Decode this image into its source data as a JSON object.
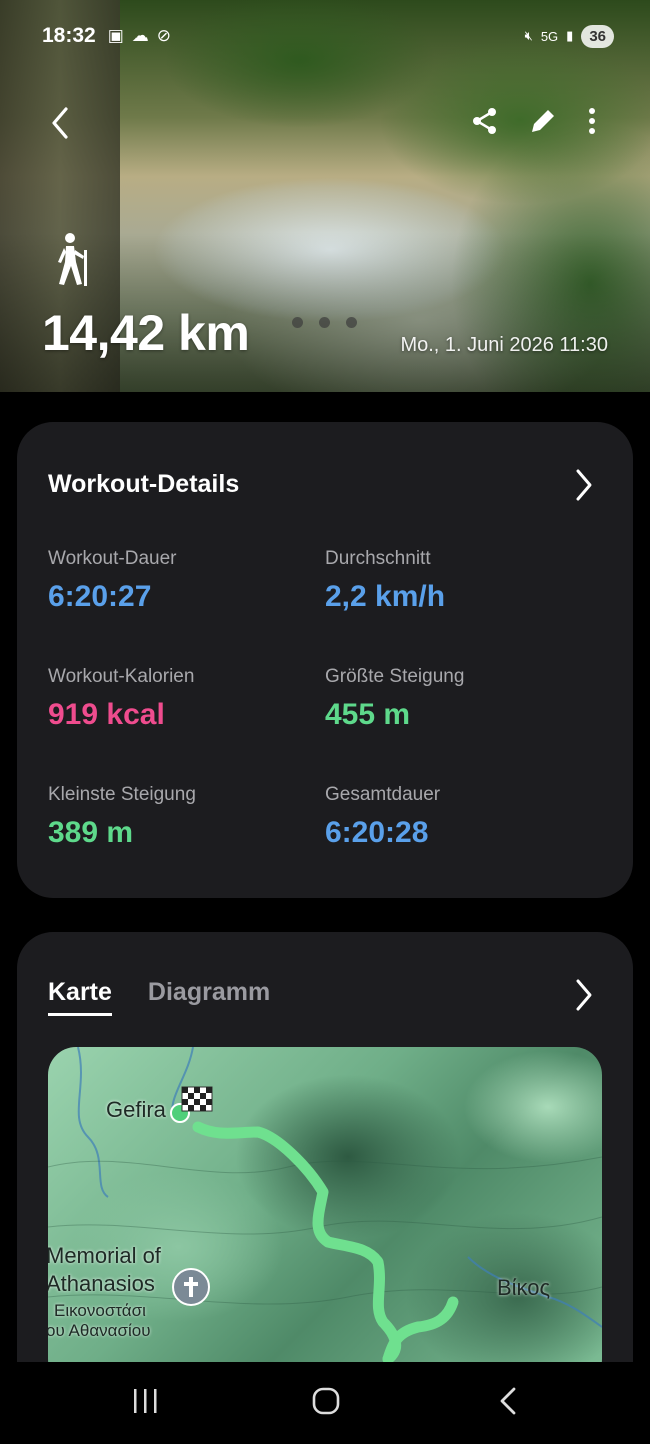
{
  "status_bar": {
    "time": "18:32",
    "network": "5G",
    "battery": "36"
  },
  "hero": {
    "distance": "14,42 km",
    "date": "Mo., 1. Juni 2026 11:30",
    "icons": [
      "back-arrow-icon",
      "share-icon",
      "edit-pencil-icon",
      "more-vertical-icon",
      "hiking-icon"
    ]
  },
  "workout_details": {
    "title": "Workout-Details",
    "stats": [
      {
        "label": "Workout-Dauer",
        "value": "6:20:27",
        "color": "#5aa0ea"
      },
      {
        "label": "Durchschnitt",
        "value": "2,2 km/h",
        "color": "#5aa0ea"
      },
      {
        "label": "Workout-Kalorien",
        "value": "919 kcal",
        "color": "#ef4c8e"
      },
      {
        "label": "Größte Steigung",
        "value": "455 m",
        "color": "#5ed98b"
      },
      {
        "label": "Kleinste Steigung",
        "value": "389 m",
        "color": "#5ed98b"
      },
      {
        "label": "Gesamtdauer",
        "value": "6:20:28",
        "color": "#5aa0ea"
      }
    ]
  },
  "map_card": {
    "tabs": [
      {
        "label": "Karte",
        "active": true
      },
      {
        "label": "Diagramm",
        "active": false
      }
    ],
    "labels": {
      "gefira": "Gefira",
      "memorial_line1": "Memorial of",
      "memorial_line2": "Athanasios",
      "greek_line1": "Εικονοστάσι",
      "greek_line2": "ου Αθανασίου",
      "vikos": "Βίκος"
    },
    "route_color": "#6fe08f"
  },
  "nav_bar": {
    "icons": [
      "recent-apps-icon",
      "home-icon",
      "back-icon"
    ]
  }
}
